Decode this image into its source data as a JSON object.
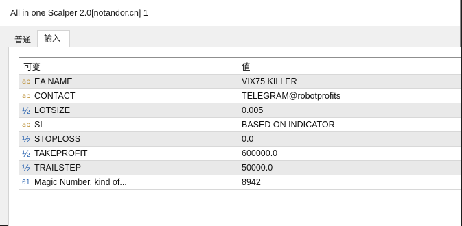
{
  "window": {
    "title": "All in one Scalper 2.0[notandor.cn] 1"
  },
  "tabs": [
    {
      "label": "普通",
      "active": false
    },
    {
      "label": "输入",
      "active": true
    }
  ],
  "table": {
    "headers": {
      "variable": "可变",
      "value": "值"
    },
    "rows": [
      {
        "type": "string",
        "type_icon": "ab",
        "name": "EA NAME",
        "value": "VIX75 KILLER"
      },
      {
        "type": "string",
        "type_icon": "ab",
        "name": "CONTACT",
        "value": "TELEGRAM@robotprofits"
      },
      {
        "type": "double",
        "type_icon": "½",
        "name": "LOTSIZE",
        "value": "0.005"
      },
      {
        "type": "string",
        "type_icon": "ab",
        "name": "SL",
        "value": "BASED ON INDICATOR"
      },
      {
        "type": "double",
        "type_icon": "½",
        "name": "STOPLOSS",
        "value": "0.0"
      },
      {
        "type": "double",
        "type_icon": "½",
        "name": "TAKEPROFIT",
        "value": "600000.0"
      },
      {
        "type": "double",
        "type_icon": "½",
        "name": "TRAILSTEP",
        "value": "50000.0"
      },
      {
        "type": "int",
        "type_icon": "01",
        "name": "Magic Number, kind of...",
        "value": "8942"
      }
    ]
  },
  "colors": {
    "string_icon": "#b7892a",
    "numeric_icon": "#2a64b0",
    "alt_row": "#e9e9e9"
  }
}
